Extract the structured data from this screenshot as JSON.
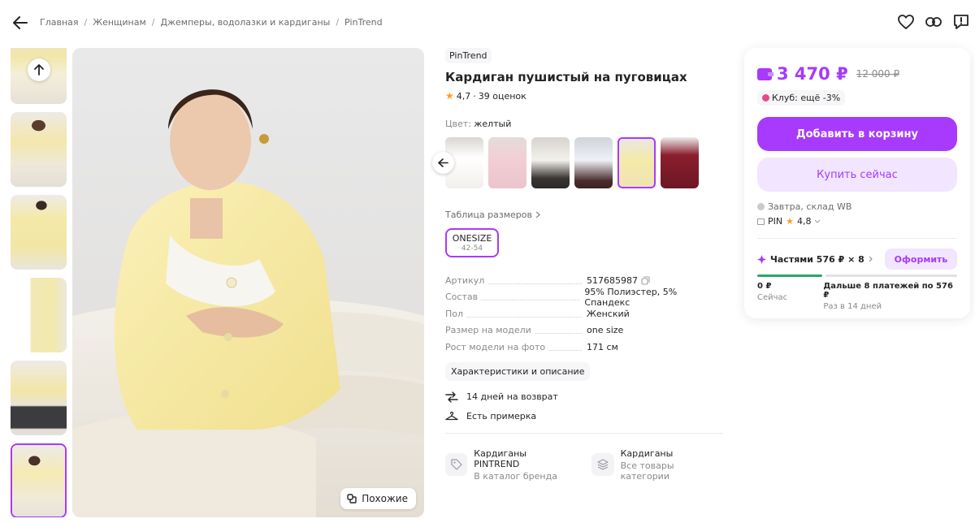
{
  "breadcrumbs": [
    "Главная",
    "Женщинам",
    "Джемперы, водолазки и кардиганы",
    "PinTrend"
  ],
  "product": {
    "brand": "PinTrend",
    "title": "Кардиган пушистый на пуговицах",
    "rating": "4,7",
    "reviews": "39 оценок",
    "color_label": "Цвет:",
    "color_value": "желтый",
    "size_table": "Таблица размеров",
    "size": {
      "name": "ONESIZE",
      "range": "42-54"
    },
    "specs": [
      {
        "key": "Артикул",
        "value": "517685987"
      },
      {
        "key": "Состав",
        "value": "95% Полиэстер, 5% Спандекс"
      },
      {
        "key": "Пол",
        "value": "Женский"
      },
      {
        "key": "Размер на модели",
        "value": "one size"
      },
      {
        "key": "Рост модели на фото",
        "value": "171 см"
      }
    ],
    "chars_button": "Характеристики и описание",
    "perks": [
      "14 дней на возврат",
      "Есть примерка"
    ],
    "categories": [
      {
        "title": "Кардиганы PINTREND",
        "subtitle": "В каталог бренда"
      },
      {
        "title": "Кардиганы",
        "subtitle": "Все товары категории"
      }
    ]
  },
  "gallery": {
    "similar_label": "Похожие"
  },
  "buy": {
    "price": "3 470 ₽",
    "old_price": "12 000 ₽",
    "club": "Клуб: ещё -3%",
    "add_to_cart": "Добавить в корзину",
    "buy_now": "Купить сейчас",
    "delivery": "Завтра, склад WB",
    "seller": "PIN",
    "seller_rating": "4,8",
    "split_label": "Частями 576 ₽ × 8",
    "split_button": "Оформить",
    "pay_now": {
      "amount": "0 ₽",
      "when": "Сейчас"
    },
    "pay_later": {
      "amount": "Дальше 8 платежей по 576 ₽",
      "when": "Раз в 14 дней"
    }
  },
  "colors": {
    "accent": "#a73afd",
    "accent_light": "#f2e5ff",
    "star": "#ff9f1a",
    "progress_done": "#2ba66b"
  },
  "icons": [
    "back-arrow-icon",
    "heart-icon",
    "link-icon",
    "report-icon",
    "arrow-up-icon",
    "similar-icon",
    "arrow-left-icon",
    "chevron-right-icon",
    "copy-icon",
    "return-icon",
    "hanger-icon",
    "tag-icon",
    "stack-icon",
    "wallet-icon",
    "split-icon"
  ]
}
